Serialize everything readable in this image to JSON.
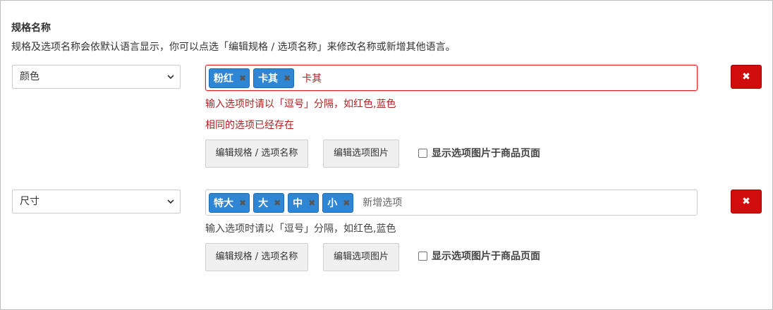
{
  "section": {
    "title": "规格名称",
    "description": "规格及选项名称会依默认语言显示，你可以点选「编辑规格 / 选项名称」来修改名称或新增其他语言。"
  },
  "specs": [
    {
      "name": "颜色",
      "tags": [
        "粉红",
        "卡其"
      ],
      "input_value": "卡其",
      "input_placeholder": "",
      "hint": "输入选项时请以「逗号」分隔，如红色,蓝色",
      "error": "相同的选项已经存在",
      "edit_button": "编辑规格 / 选项名称",
      "image_button": "编辑选项图片",
      "show_images_label": "显示选项图片于商品页面",
      "show_images_checked": false,
      "delete_icon": "close-icon"
    },
    {
      "name": "尺寸",
      "tags": [
        "特大",
        "大",
        "中",
        "小"
      ],
      "input_value": "",
      "input_placeholder": "新增选项",
      "hint": "输入选项时请以「逗号」分隔，如红色,蓝色",
      "edit_button": "编辑规格 / 选项名称",
      "image_button": "编辑选项图片",
      "show_images_label": "显示选项图片于商品页面",
      "show_images_checked": false,
      "delete_icon": "close-icon"
    }
  ],
  "colors": {
    "tag_bg": "#2e86d4",
    "error_text": "#b22222",
    "error_border": "#dc1f1f",
    "delete_button_bg": "#d10c0c"
  }
}
